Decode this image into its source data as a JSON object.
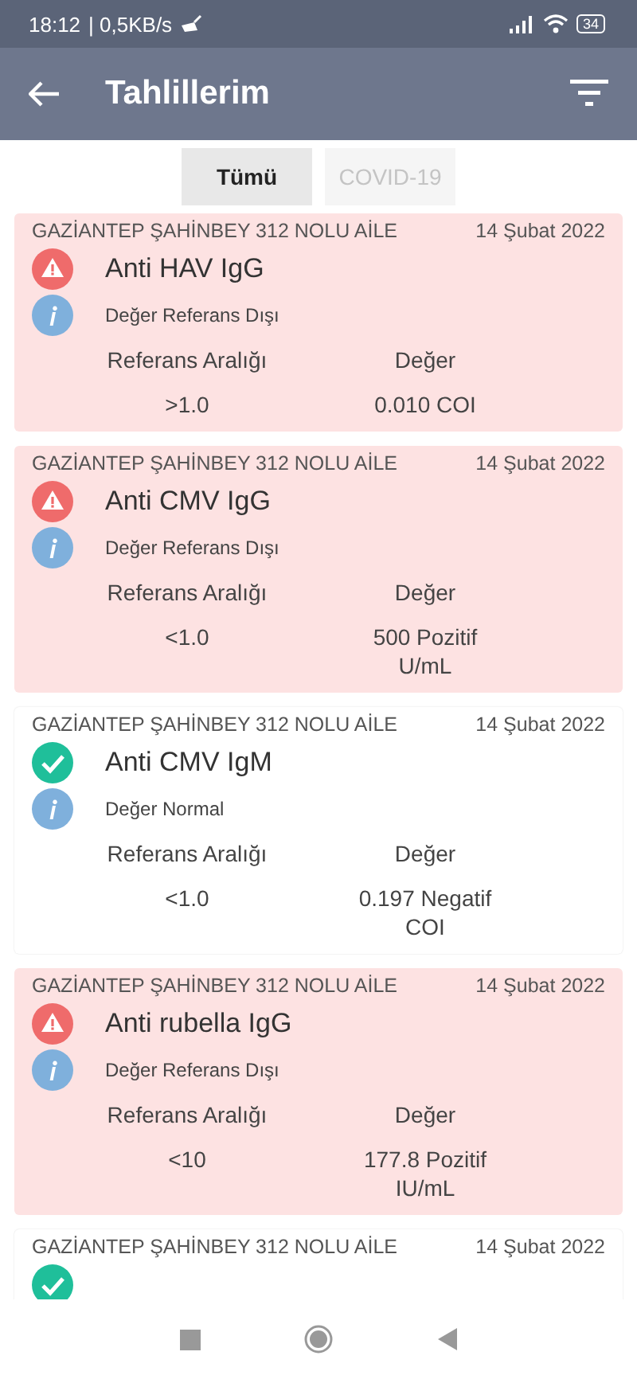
{
  "status_bar": {
    "time": "18:12",
    "speed": "| 0,5KB/s",
    "battery": "34"
  },
  "header": {
    "title": "Tahlillerim"
  },
  "tabs": [
    {
      "label": "Tümü",
      "selected": true
    },
    {
      "label": "COVID-19",
      "selected": false
    }
  ],
  "results": [
    {
      "clinic": "GAZİANTEP ŞAHİNBEY 312 NOLU AİLE",
      "date": "14 Şubat 2022",
      "kind": "abnormal",
      "name": "Anti HAV IgG",
      "note": "Değer Referans Dışı",
      "range_label": "Referans Aralığı",
      "value_label": "Değer",
      "range": ">1.0",
      "value": "0.010 COI"
    },
    {
      "clinic": "GAZİANTEP ŞAHİNBEY 312 NOLU AİLE",
      "date": "14 Şubat 2022",
      "kind": "abnormal",
      "name": "Anti CMV IgG",
      "note": "Değer Referans Dışı",
      "range_label": "Referans Aralığı",
      "value_label": "Değer",
      "range": "<1.0",
      "value": "500 Pozitif U/mL"
    },
    {
      "clinic": "GAZİANTEP ŞAHİNBEY 312 NOLU AİLE",
      "date": "14 Şubat 2022",
      "kind": "normal",
      "name": "Anti CMV IgM",
      "note": "Değer Normal",
      "range_label": "Referans Aralığı",
      "value_label": "Değer",
      "range": "<1.0",
      "value": "0.197 Negatif COI"
    },
    {
      "clinic": "GAZİANTEP ŞAHİNBEY 312 NOLU AİLE",
      "date": "14 Şubat 2022",
      "kind": "abnormal",
      "name": "Anti rubella IgG",
      "note": "Değer Referans Dışı",
      "range_label": "Referans Aralığı",
      "value_label": "Değer",
      "range": "<10",
      "value": "177.8 Pozitif IU/mL"
    },
    {
      "clinic": "GAZİANTEP ŞAHİNBEY 312 NOLU AİLE",
      "date": "14 Şubat 2022",
      "kind": "normal"
    }
  ]
}
